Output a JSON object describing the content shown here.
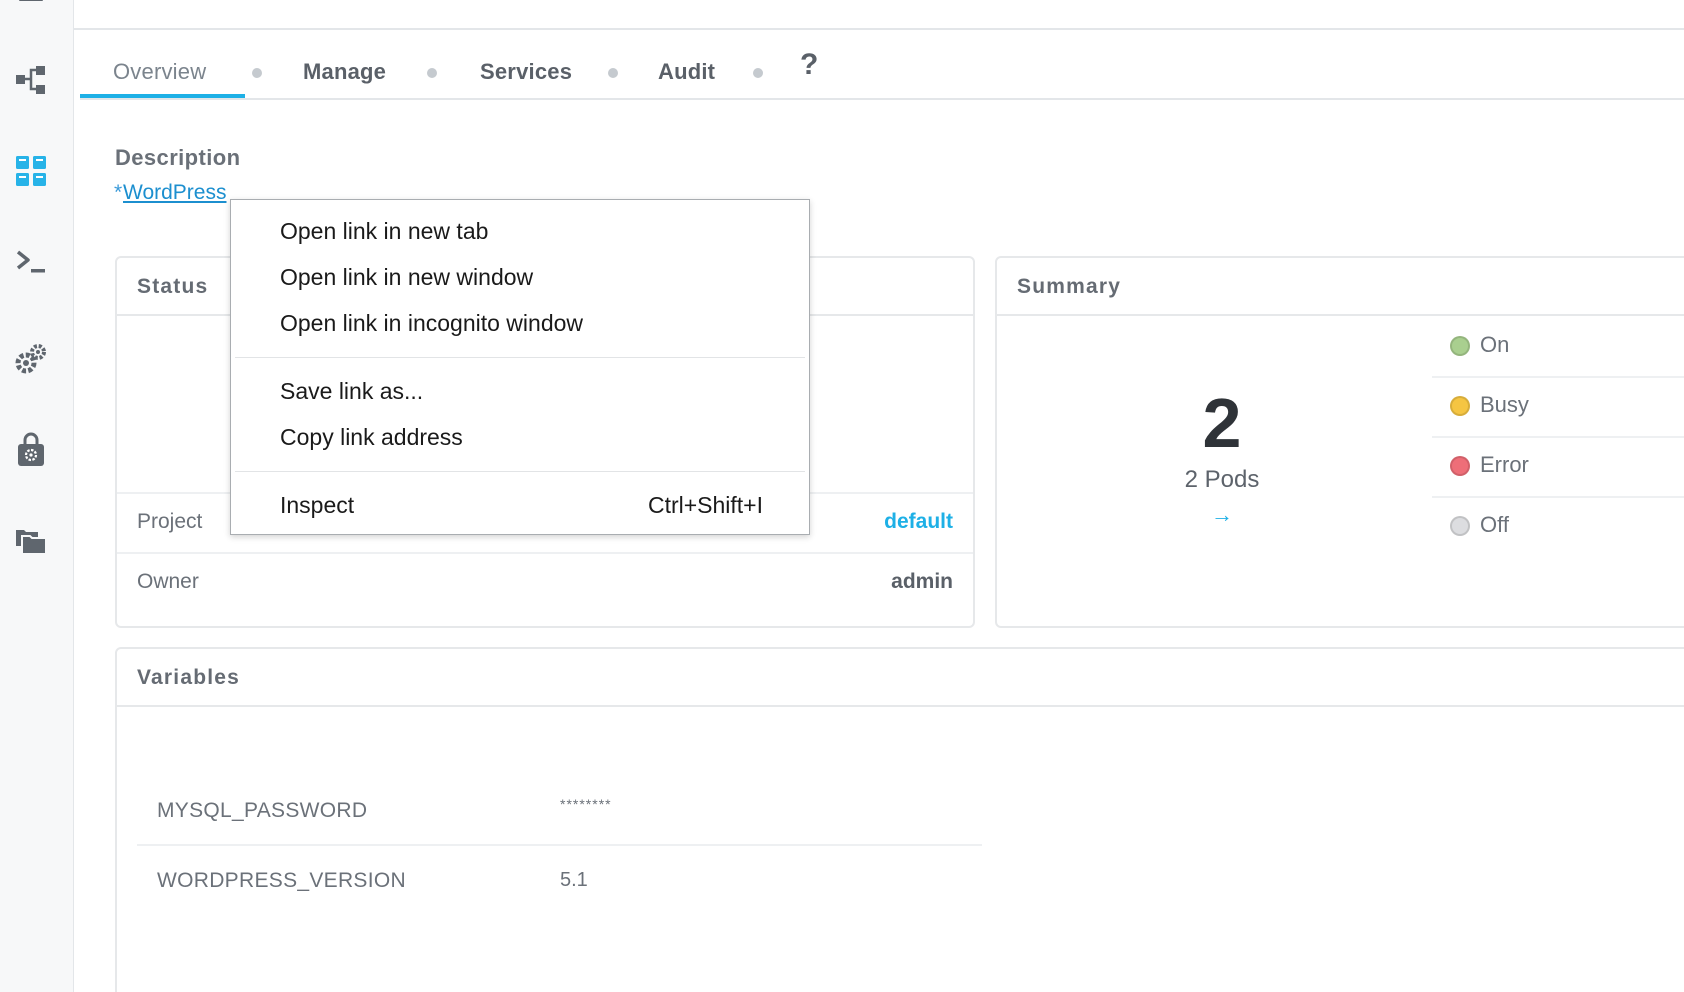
{
  "rail": {
    "icons": [
      "menu-icon",
      "topology-icon",
      "dashboard-icon",
      "terminal-icon",
      "gears-icon",
      "lock-bag-icon",
      "folders-icon"
    ]
  },
  "tabs": {
    "items": [
      "Overview",
      "Manage",
      "Services",
      "Audit"
    ],
    "active": "Overview",
    "help": "?"
  },
  "description": {
    "label": "Description",
    "prefix": "*",
    "link_text": "WordPress"
  },
  "status": {
    "title": "Status",
    "rows": [
      {
        "label": "Project",
        "value": "default"
      },
      {
        "label": "Owner",
        "value": "admin"
      }
    ]
  },
  "summary": {
    "title": "Summary",
    "count": "2",
    "pods_label": "2 Pods",
    "arrow": "→",
    "legend": [
      {
        "label": "On",
        "color": "#a9cf8f"
      },
      {
        "label": "Busy",
        "color": "#f5c542"
      },
      {
        "label": "Error",
        "color": "#ee6e78"
      },
      {
        "label": "Off",
        "color": "#dcdde0"
      }
    ]
  },
  "variables": {
    "title": "Variables",
    "rows": [
      {
        "name": "MYSQL_PASSWORD",
        "value": "********"
      },
      {
        "name": "WORDPRESS_VERSION",
        "value": "5.1"
      }
    ]
  },
  "context_menu": {
    "items": [
      {
        "label": "Open link in new tab"
      },
      {
        "label": "Open link in new window"
      },
      {
        "label": "Open link in incognito window"
      },
      {
        "label": "Save link as..."
      },
      {
        "label": "Copy link address"
      },
      {
        "label": "Inspect",
        "shortcut": "Ctrl+Shift+I"
      }
    ]
  },
  "colors": {
    "accent": "#1eb0e6",
    "link": "#1c8fcf"
  }
}
